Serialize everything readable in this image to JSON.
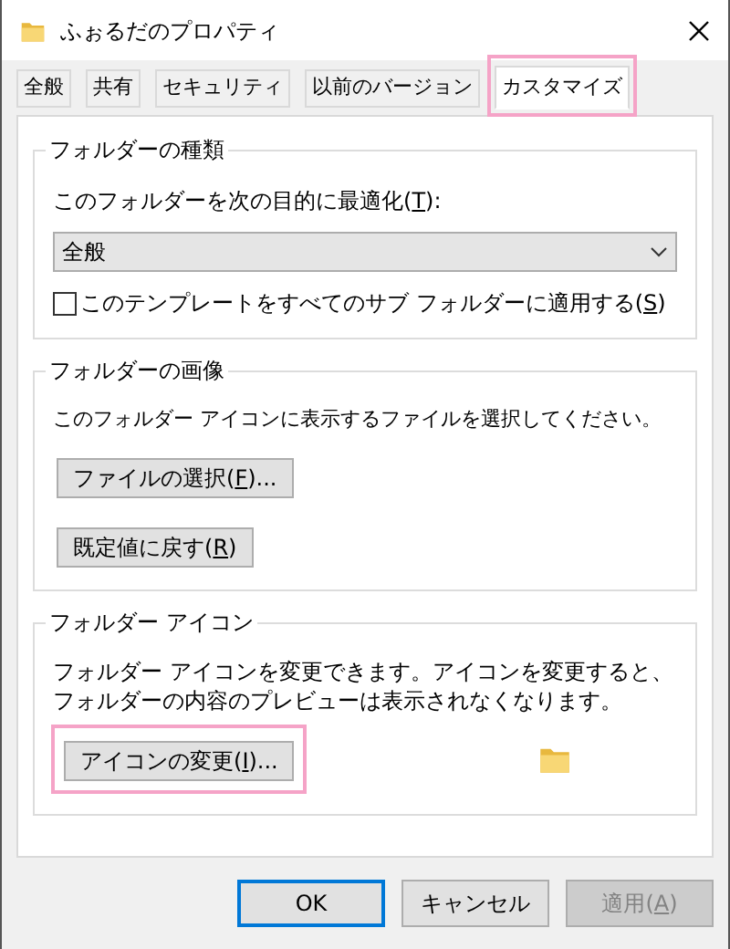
{
  "window": {
    "title": "ふぉるだのプロパティ"
  },
  "tabs": [
    {
      "label": "全般",
      "selected": false,
      "highlighted": false
    },
    {
      "label": "共有",
      "selected": false,
      "highlighted": false
    },
    {
      "label": "セキュリティ",
      "selected": false,
      "highlighted": false
    },
    {
      "label": "以前のバージョン",
      "selected": false,
      "highlighted": false
    },
    {
      "label": "カスタマイズ",
      "selected": true,
      "highlighted": true
    }
  ],
  "folder_type": {
    "heading": "フォルダーの種類",
    "optimize_label": {
      "before": "このフォルダーを次の目的に最適化(",
      "key": "T",
      "after": "):"
    },
    "dropdown_value": "全般",
    "apply_checkbox": {
      "before": "このテンプレートをすべてのサブ フォルダーに適用する(",
      "key": "S",
      "after": ")",
      "checked": false
    }
  },
  "folder_picture": {
    "heading": "フォルダーの画像",
    "description": "このフォルダー アイコンに表示するファイルを選択してください。",
    "buttons": [
      {
        "before": "ファイルの選択(",
        "key": "F",
        "after": ")..."
      },
      {
        "before": "既定値に戻す(",
        "key": "R",
        "after": ")"
      }
    ]
  },
  "folder_icon": {
    "heading": "フォルダー アイコン",
    "description": "フォルダー アイコンを変更できます。アイコンを変更すると、フォルダーの内容のプレビューは表示されなくなります。",
    "button": {
      "before": "アイコンの変更(",
      "key": "I",
      "after": ")...",
      "highlighted": true
    }
  },
  "footer_buttons": [
    {
      "label": "OK",
      "kind": "default",
      "disabled": false
    },
    {
      "label": "キャンセル",
      "kind": "normal",
      "disabled": false
    },
    {
      "label": "適用(",
      "key": "A",
      "after": ")",
      "kind": "normal",
      "disabled": true
    }
  ]
}
